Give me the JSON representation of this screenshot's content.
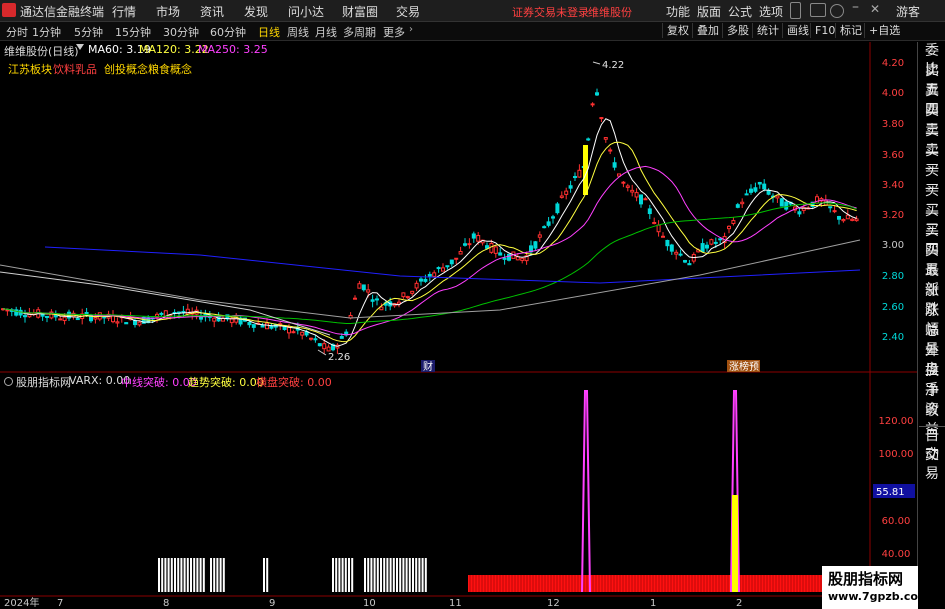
{
  "menubar": {
    "app_title": "通达信金融终端",
    "menus": [
      "行情",
      "市场",
      "资讯",
      "发现",
      "问小达",
      "财富圈",
      "交易"
    ],
    "warning": "证券交易未登录",
    "stock_name": "维维股份",
    "right_menus": [
      "功能",
      "版面",
      "公式",
      "选项"
    ],
    "guest": "游客"
  },
  "toolbar": {
    "periods": [
      "分时",
      "1分钟",
      "5分钟",
      "15分钟",
      "30分钟",
      "60分钟",
      "日线",
      "周线",
      "月线",
      "多周期",
      "更多"
    ],
    "active_period": "日线",
    "tools": [
      "复权",
      "叠加",
      "多股",
      "统计",
      "画线",
      "F10",
      "标记",
      "+自选"
    ]
  },
  "main_chart": {
    "stock_label": "维维股份(日线)",
    "ma60": "MA60: 3.19",
    "ma120": "MA120: 3.22",
    "ma250": "MA250: 3.25",
    "concept_1": "江苏板块",
    "concept_2": "饮料乳品",
    "concept_3": "创投概念",
    "concept_4": "粮食概念",
    "high_label": "4.22",
    "low_label": "2.26",
    "event_1": "财",
    "event_2": "涨榜预",
    "colors": {
      "up": "#ff3030",
      "down": "#00d8d8",
      "ma60": "#00c000",
      "ma120": "#2020ff",
      "ma250": "#a0a0a0"
    }
  },
  "indicator": {
    "name": "股朋指标网",
    "varx": "VARX: 0.00",
    "mid_break": "中线突破: 0.00",
    "trend_break": "趋势突破: 0.00",
    "sideways_break": "横盘突破: 0.00",
    "current_value": "55.81"
  },
  "right_panel": {
    "items": [
      "委比",
      "卖五",
      "卖四",
      "卖三",
      "卖二",
      "卖一",
      "买一",
      "买二",
      "买三",
      "买四",
      "买五",
      "最新",
      "涨跌",
      "涨幅",
      "总量",
      "外盘",
      "换手",
      "净资",
      "收益",
      "自动",
      "交易"
    ]
  },
  "watermark": {
    "title": "股朋指标网",
    "url": "www.7gpzb.com"
  },
  "chart_data": [
    {
      "type": "line",
      "title": "",
      "ylim": [
        2.26,
        4.3
      ],
      "y_ticks": [
        4.2,
        4.0,
        3.8,
        3.6,
        3.4,
        3.2,
        3.0,
        2.8,
        2.6,
        2.4
      ],
      "x_ticks": [
        "2024年",
        "7",
        "8",
        "9",
        "10",
        "11",
        "12",
        "1",
        "2"
      ],
      "annotations": {
        "high": 4.22,
        "low": 2.26
      }
    },
    {
      "type": "bar",
      "title": "",
      "ylim": [
        10,
        130
      ],
      "y_ticks": [
        120.0,
        100.0,
        80.0,
        60.0,
        40.0,
        20.0
      ],
      "current": 55.81
    }
  ]
}
